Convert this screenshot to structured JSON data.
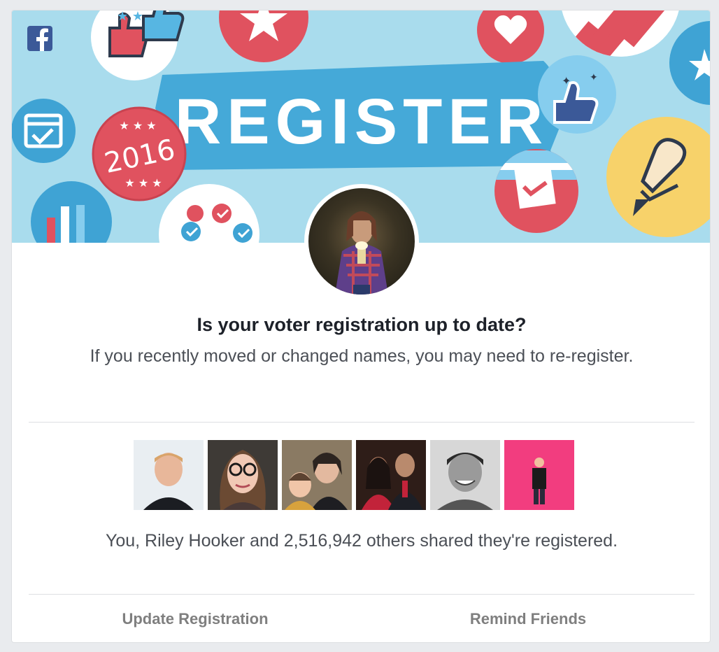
{
  "banner": {
    "title": "REGISTER",
    "year_badge": "2016"
  },
  "prompt": {
    "headline": "Is your voter registration up to date?",
    "subtext": "If you recently moved or changed names, you may need to re-register."
  },
  "social": {
    "shared_text": "You, Riley Hooker and 2,516,942 others shared they're registered."
  },
  "actions": {
    "update_label": "Update Registration",
    "remind_label": "Remind Friends"
  },
  "colors": {
    "banner_bg": "#a9dced",
    "ribbon": "#45a9d8",
    "badge_red": "#e0525f",
    "badge_yellow": "#f7d26a",
    "facebook_blue": "#3b5998",
    "action_text": "#7f7f7f"
  },
  "icons": [
    "facebook-logo-icon",
    "thumbs-up-icon",
    "star-icon",
    "heart-icon",
    "calendar-check-icon",
    "checkmark-icon",
    "pencil-heart-icon",
    "raised-hands-icon"
  ]
}
